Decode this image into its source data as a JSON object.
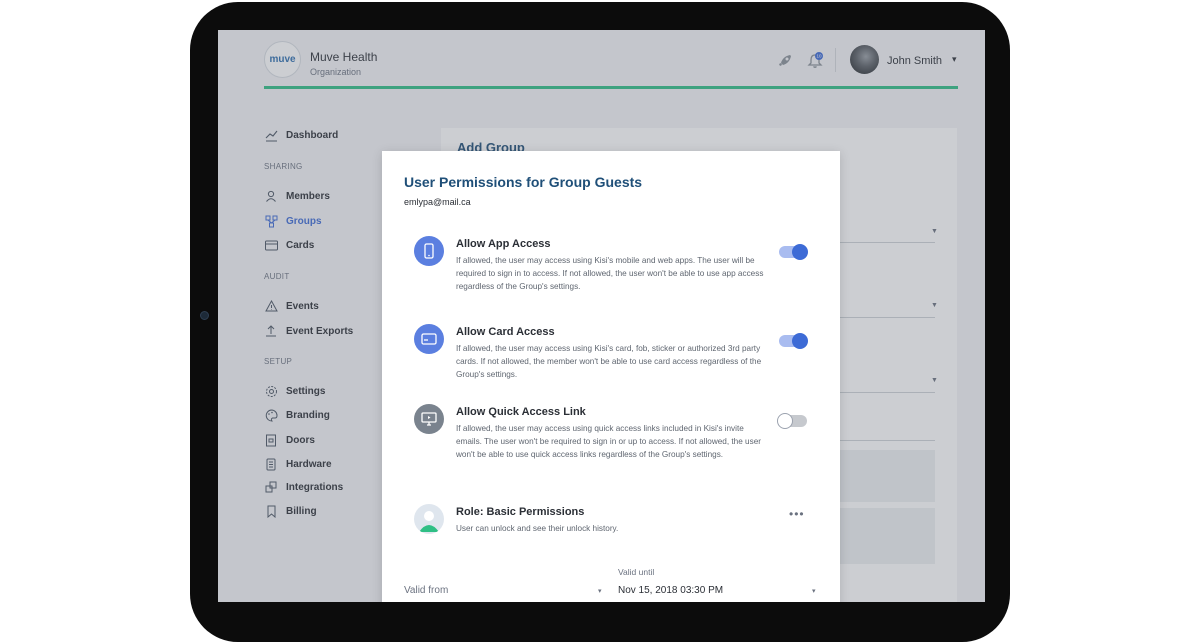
{
  "header": {
    "logo_text": "muve",
    "org_name": "Muve Health",
    "org_subtitle": "Organization",
    "notification_count": "10",
    "user_name": "John Smith",
    "user_caret": "▾"
  },
  "sidebar": {
    "items": [
      {
        "label": "Dashboard",
        "icon": "chart-line-icon"
      },
      {
        "label": "Members",
        "icon": "user-icon"
      },
      {
        "label": "Groups",
        "icon": "group-icon",
        "active": true
      },
      {
        "label": "Cards",
        "icon": "card-icon"
      },
      {
        "label": "Events",
        "icon": "warning-icon"
      },
      {
        "label": "Event Exports",
        "icon": "upload-icon"
      },
      {
        "label": "Settings",
        "icon": "gear-icon"
      },
      {
        "label": "Branding",
        "icon": "palette-icon"
      },
      {
        "label": "Doors",
        "icon": "door-icon"
      },
      {
        "label": "Hardware",
        "icon": "hardware-icon"
      },
      {
        "label": "Integrations",
        "icon": "integrations-icon"
      },
      {
        "label": "Billing",
        "icon": "bookmark-icon"
      }
    ],
    "sections": {
      "sharing": "SHARING",
      "audit": "AUDIT",
      "setup": "SETUP"
    }
  },
  "background": {
    "title": "Add Group"
  },
  "modal": {
    "title": "User Permissions for Group Guests",
    "email": "emlypa@mail.ca",
    "permissions": [
      {
        "title": "Allow App Access",
        "description": "If allowed, the user may access using Kisi's mobile and web apps. The user will be required to sign in to access. If not allowed, the user won't be able to use app access regardless of the Group's settings.",
        "enabled": true,
        "icon": "phone-icon"
      },
      {
        "title": "Allow Card Access",
        "description": "If allowed, the user may access using Kisi's card, fob, sticker or authorized 3rd party cards. If not allowed, the member won't be able to use card access regardless of the Group's settings.",
        "enabled": true,
        "icon": "card-icon"
      },
      {
        "title": "Allow Quick Access Link",
        "description": "If allowed, the user may access using quick access links included in Kisi's invite emails. The user won't be required to sign in or up to access. If not allowed, the user won't be able to use quick access links regardless of the Group's settings.",
        "enabled": false,
        "icon": "monitor-icon"
      }
    ],
    "role": {
      "title": "Role: Basic Permissions",
      "description": "User can unlock and see their unlock history.",
      "menu": "•••"
    },
    "valid_from": {
      "placeholder": "Valid from",
      "caret": "▾"
    },
    "valid_until": {
      "label": "Valid until",
      "value": "Nov 15, 2018 03:30 PM",
      "caret": "▾"
    }
  },
  "colors": {
    "accent": "#3d6bd6",
    "brand_green": "#2fbf85",
    "title_blue": "#1f4f78"
  }
}
